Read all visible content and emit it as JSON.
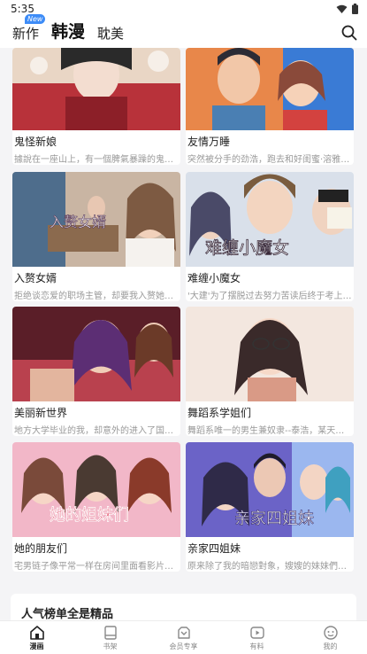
{
  "status_bar": {
    "time": "5:35"
  },
  "top_nav": {
    "tabs": [
      {
        "label": "新作",
        "badge": "New"
      },
      {
        "label": "韩漫"
      },
      {
        "label": "耽美"
      }
    ]
  },
  "cards": [
    {
      "title": "鬼怪新娘",
      "desc": "據說在一座山上，有一個脾氣暴躁的鬼怪，",
      "palette": [
        "#b8323a",
        "#2a2a2a",
        "#e9d6c5"
      ]
    },
    {
      "title": "友情万睡",
      "desc": "突然被分手的劲浩，跑去和好闺蜜·溶雅一起",
      "palette": [
        "#3a7bd5",
        "#f2c7a8",
        "#e8874a"
      ]
    },
    {
      "title": "入赘女婿",
      "desc": "拒绝谈恋爱的职场主管，却要我入赘她家！",
      "palette": [
        "#7d6a5a",
        "#c9b5a3",
        "#4e6d8c"
      ]
    },
    {
      "title": "难缠小魔女",
      "desc": "'大建'为了摆脱过去努力苦读后终于考上名校",
      "palette": [
        "#4a4a68",
        "#d9c2b0",
        "#7a5c3e"
      ]
    },
    {
      "title": "美丽新世界",
      "desc": "地方大学毕业的我，却意外的进入了国家最",
      "palette": [
        "#5a1e28",
        "#b9414e",
        "#e3b59e"
      ]
    },
    {
      "title": "舞蹈系学姐们",
      "desc": "舞蹈系唯一的男生兼奴隶--泰浩，某天在宗",
      "palette": [
        "#f3e7df",
        "#d99a86",
        "#3a2a2a"
      ]
    },
    {
      "title": "她的朋友们",
      "desc": "宅男链子像平常一样在房间里面看影片，却",
      "palette": [
        "#f2b7c8",
        "#e5677e",
        "#7a4a3a"
      ]
    },
    {
      "title": "亲家四姐妹",
      "desc": "原来除了我的暗戀對象，嫂嫂的妹妹們也跟",
      "palette": [
        "#6b63c7",
        "#9bb7ef",
        "#2f2a48"
      ]
    }
  ],
  "cover_text": {
    "c3": "入赘女婿",
    "c4": "难缠小魔女",
    "c7": "她的姐妹们",
    "c8": "亲家四姐妹"
  },
  "ranking": {
    "title": "人气榜单全是精品"
  },
  "bottom_nav": {
    "items": [
      {
        "label": "漫画",
        "icon": "home-icon",
        "active": true
      },
      {
        "label": "书架",
        "icon": "bookshelf-icon"
      },
      {
        "label": "会员专享",
        "icon": "vip-icon"
      },
      {
        "label": "有料",
        "icon": "play-icon"
      },
      {
        "label": "我的",
        "icon": "profile-icon"
      }
    ]
  },
  "colors": {
    "accent": "#3d8cf7",
    "background": "#f4f4f6"
  }
}
